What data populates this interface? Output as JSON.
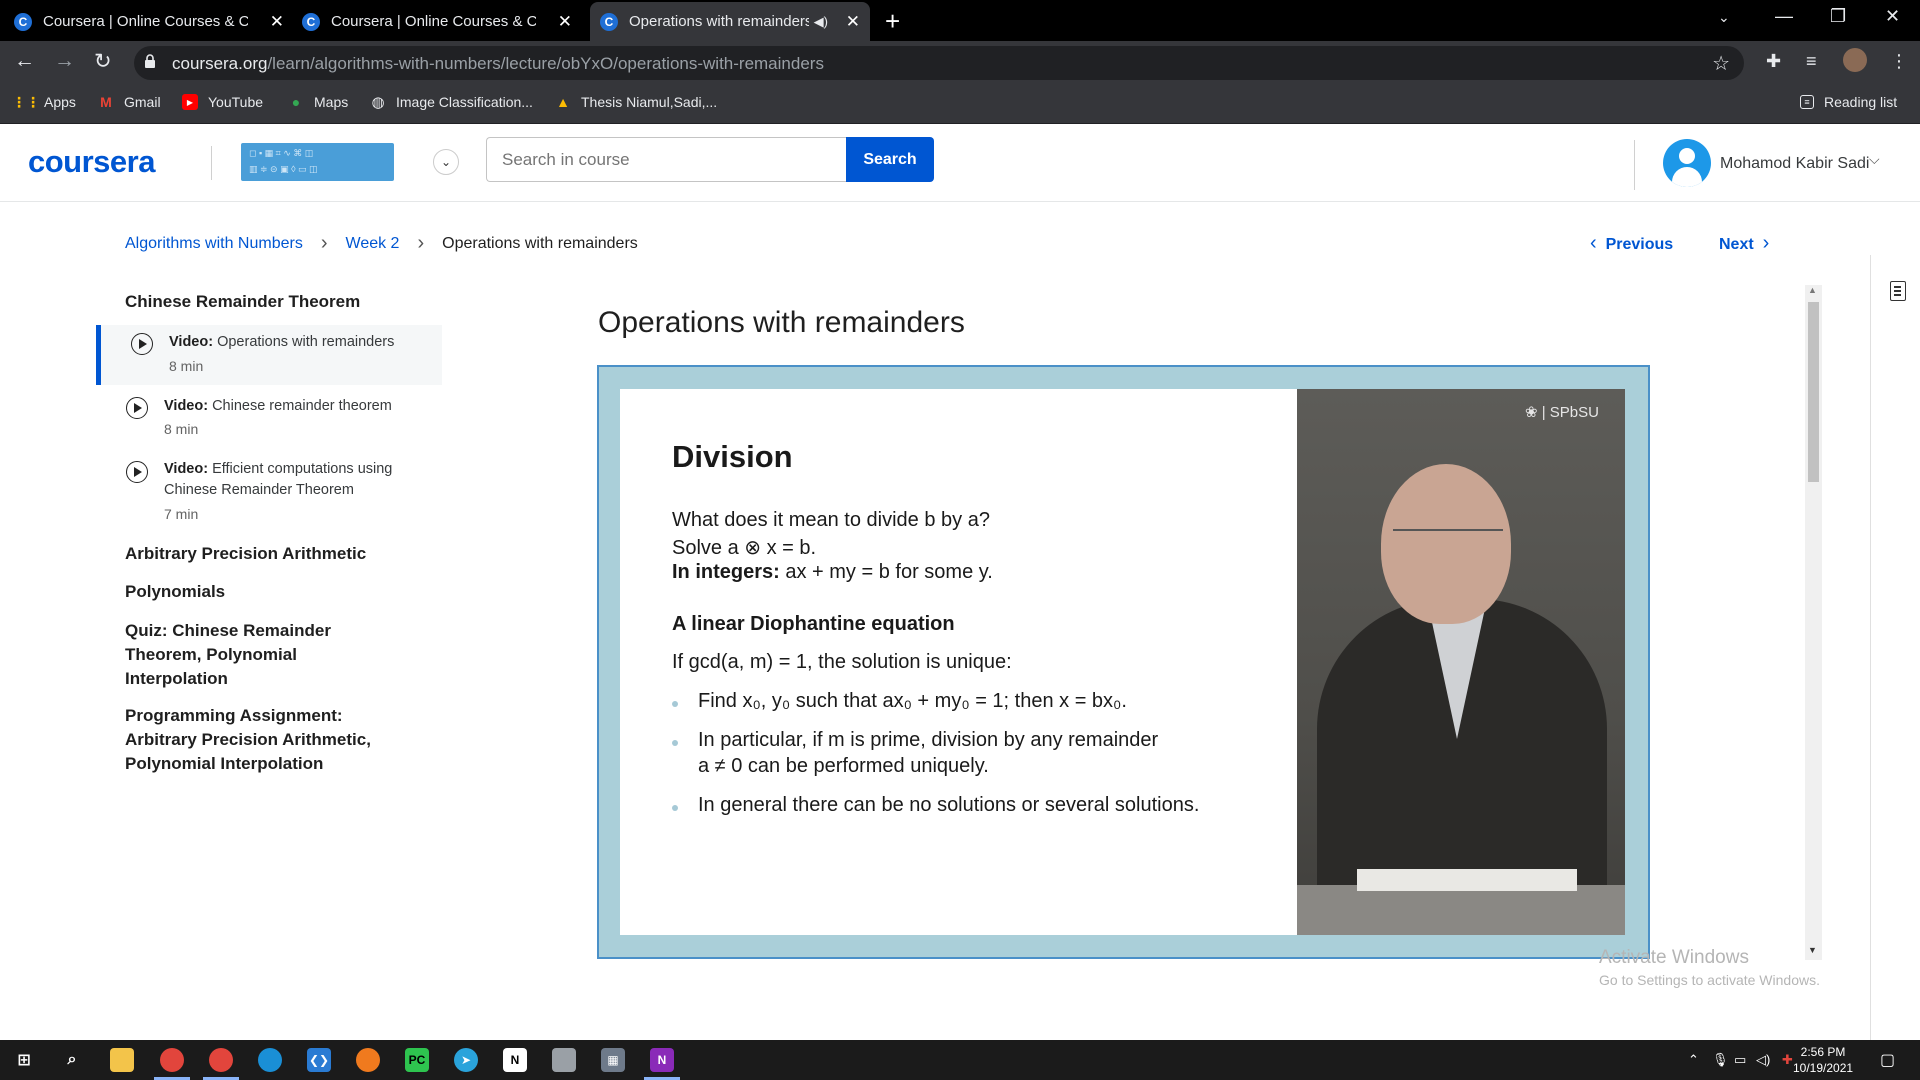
{
  "browser": {
    "tabs": [
      {
        "title": "Coursera | Online Courses & Credentials",
        "favicon": "C"
      },
      {
        "title": "Coursera | Online Courses & Credentials",
        "favicon": "C"
      },
      {
        "title": "Operations with remainders |",
        "favicon": "C"
      }
    ],
    "url_host": "coursera.org",
    "url_path": "/learn/algorithms-with-numbers/lecture/obYxO/operations-with-remainders",
    "bookmarks": [
      "Apps",
      "Gmail",
      "YouTube",
      "Maps",
      "Image Classification...",
      "Thesis Niamul,Sadi,..."
    ],
    "reading_list": "Reading list"
  },
  "header": {
    "logo": "coursera",
    "search_placeholder": "Search in course",
    "search_button": "Search",
    "user_name": "Mohamod Kabir Sadi"
  },
  "breadcrumb": {
    "course": "Algorithms with Numbers",
    "week": "Week 2",
    "current": "Operations with remainders"
  },
  "nav": {
    "previous": "Previous",
    "next": "Next"
  },
  "sidebar": {
    "section1": "Chinese Remainder Theorem",
    "items": [
      {
        "kind": "Video:",
        "title": "Operations with remainders",
        "duration": "8 min"
      },
      {
        "kind": "Video:",
        "title": "Chinese remainder theorem",
        "duration": "8 min"
      },
      {
        "kind": "Video:",
        "title": "Efficient computations using Chinese Remainder Theorem",
        "duration": "7 min"
      }
    ],
    "sections": [
      "Arbitrary Precision Arithmetic",
      "Polynomials",
      "Quiz: Chinese Remainder Theorem, Polynomial Interpolation",
      "Programming Assignment: Arbitrary Precision Arithmetic, Polynomial Interpolation"
    ]
  },
  "lecture": {
    "title": "Operations with remainders",
    "slide_heading": "Division",
    "line1": "What does it mean to divide b by a?",
    "line2": "Solve a ⊗ x = b.",
    "line3_bold": "In integers:",
    "line3_rest": "ax + my = b for some y.",
    "subheading": "A linear Diophantine equation",
    "line4": "If gcd(a, m) = 1, the solution is unique:",
    "bullets": [
      "Find x₀, y₀ such that ax₀ + my₀ = 1; then x = bx₀.",
      "In particular, if m is prime, division by any remainder",
      "a ≠ 0 can be performed uniquely.",
      "In general there can be no solutions or several solutions."
    ],
    "video_logo": "SPbSU"
  },
  "watermark": {
    "line1": "Activate Windows",
    "line2": "Go to Settings to activate Windows."
  },
  "taskbar": {
    "time": "2:56 PM",
    "date": "10/19/2021"
  },
  "colors": {
    "brand": "#0056d2",
    "player_bg": "#aacfd9",
    "chrome_dark": "#35363a"
  }
}
